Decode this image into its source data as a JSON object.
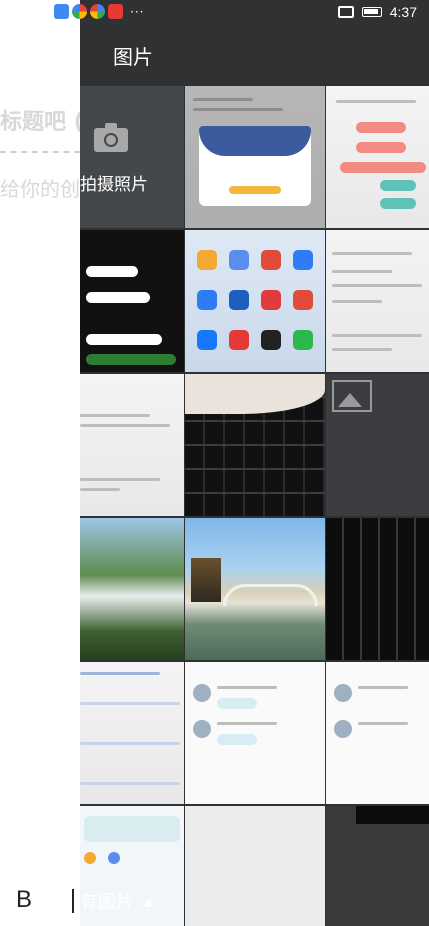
{
  "status_bar": {
    "time": "4:37",
    "more": "···"
  },
  "background_page": {
    "title_fragment": "标题吧 (最",
    "hint_fragment": "给你的创作",
    "bold_label": "B"
  },
  "picker": {
    "title": "图片",
    "camera_label": "拍摄照片",
    "album_label": "有图片"
  },
  "thumbnails": [
    "camera",
    "dialog-screenshot",
    "doc-screenshot",
    "chat-screenshot",
    "phone-home-screenshot",
    "order-screenshot",
    "order-screenshot-2",
    "keyboard-photo",
    "image-placeholder",
    "waterfall-photo",
    "bridge-photo",
    "keyboard-photo-2",
    "list-screenshot",
    "contacts-screenshot",
    "contacts-screenshot-2",
    "manage-screenshot",
    "blank-light",
    "monitor-photo"
  ]
}
